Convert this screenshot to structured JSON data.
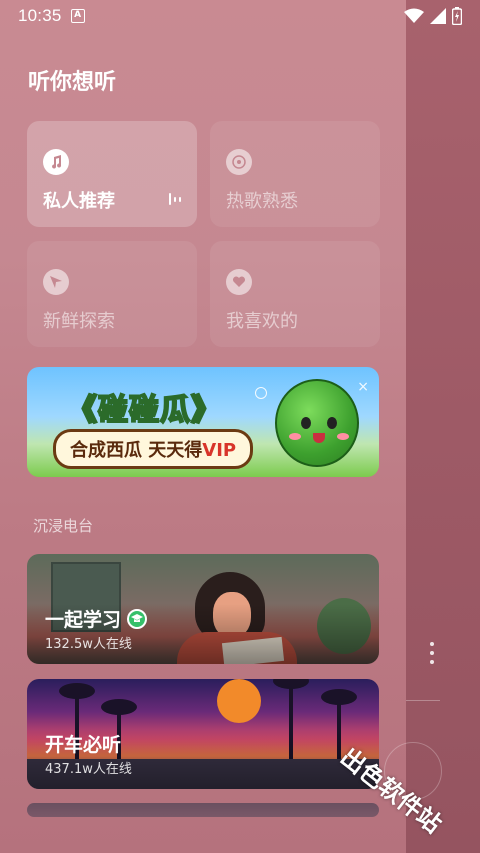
{
  "status_bar": {
    "time": "10:35",
    "notification_letter": "A"
  },
  "page": {
    "title": "听你想听"
  },
  "mode_cards": [
    {
      "label": "私人推荐",
      "icon": "music-note-icon",
      "active": true
    },
    {
      "label": "热歌熟悉",
      "icon": "disc-icon",
      "active": false
    },
    {
      "label": "新鲜探索",
      "icon": "paper-plane-icon",
      "active": false
    },
    {
      "label": "我喜欢的",
      "icon": "heart-icon",
      "active": false
    }
  ],
  "banner": {
    "title": "《碰碰瓜》",
    "slogan_prefix": "合成西瓜 天天得",
    "slogan_vip": "VIP",
    "close": "×"
  },
  "section": {
    "title": "沉浸电台"
  },
  "radios": [
    {
      "title": "一起学习",
      "listeners": "132.5w人在线",
      "verified": true
    },
    {
      "title": "开车必听",
      "listeners": "437.1w人在线",
      "verified": false
    }
  ],
  "watermark": "出色软件站",
  "colors": {
    "background": "#c58891",
    "panel": "#a0606a",
    "badge": "#36c06a"
  }
}
